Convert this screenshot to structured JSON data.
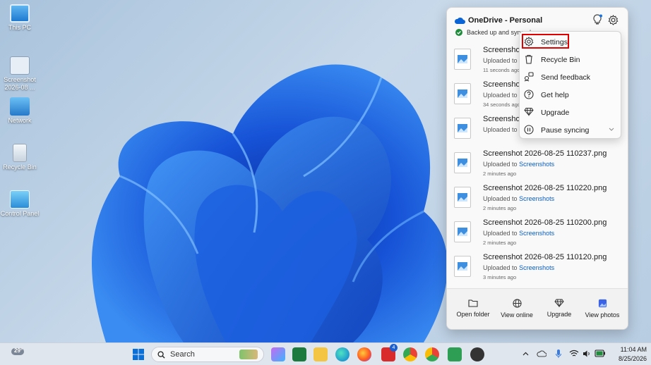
{
  "desktop": {
    "icons": [
      {
        "label": "This PC",
        "icon": "computer-icon"
      },
      {
        "label": "Screenshot 2026-08 ...",
        "icon": "screenshot-file-icon"
      },
      {
        "label": "Network",
        "icon": "network-icon"
      },
      {
        "label": "Recycle Bin",
        "icon": "recycle-bin-icon"
      },
      {
        "label": "Control Panel",
        "icon": "control-panel-icon"
      }
    ]
  },
  "onedrive": {
    "title": "OneDrive - Personal",
    "status": "Backed up and synced",
    "files": [
      {
        "name": "Screenshot",
        "sub_prefix": "Uploaded to",
        "sub_link": "",
        "time": "11 seconds ago"
      },
      {
        "name": "Screenshot",
        "sub_prefix": "Uploaded to",
        "sub_link": "",
        "time": "34 seconds ago"
      },
      {
        "name": "Screenshot",
        "sub_prefix": "Uploaded to",
        "sub_link": "",
        "time": ""
      },
      {
        "name": "Screenshot 2026-08-25 110237.png",
        "sub_prefix": "Uploaded to",
        "sub_link": "Screenshots",
        "time": "2 minutes ago"
      },
      {
        "name": "Screenshot 2026-08-25 110220.png",
        "sub_prefix": "Uploaded to",
        "sub_link": "Screenshots",
        "time": "2 minutes ago"
      },
      {
        "name": "Screenshot 2026-08-25 110200.png",
        "sub_prefix": "Uploaded to",
        "sub_link": "Screenshots",
        "time": "2 minutes ago"
      },
      {
        "name": "Screenshot 2026-08-25 110120.png",
        "sub_prefix": "Uploaded to",
        "sub_link": "Screenshots",
        "time": "3 minutes ago"
      }
    ],
    "footer": [
      {
        "label": "Open folder",
        "icon": "folder-icon"
      },
      {
        "label": "View online",
        "icon": "globe-icon"
      },
      {
        "label": "Upgrade",
        "icon": "diamond-icon"
      },
      {
        "label": "View photos",
        "icon": "photos-icon"
      }
    ]
  },
  "menu": {
    "items": [
      {
        "label": "Settings",
        "icon": "gear-icon"
      },
      {
        "label": "Recycle Bin",
        "icon": "trash-icon"
      },
      {
        "label": "Send feedback",
        "icon": "feedback-icon"
      },
      {
        "label": "Get help",
        "icon": "help-icon"
      },
      {
        "label": "Upgrade",
        "icon": "diamond-icon"
      },
      {
        "label": "Pause syncing",
        "icon": "pause-icon"
      }
    ]
  },
  "taskbar": {
    "weather": "29°",
    "search_placeholder": "Search",
    "mail_badge": "4",
    "time": "11:04 AM",
    "date": "8/25/2026"
  },
  "colors": {
    "accent": "#0a5ec2",
    "highlight": "#e00000",
    "synced": "#1e8c3a"
  }
}
